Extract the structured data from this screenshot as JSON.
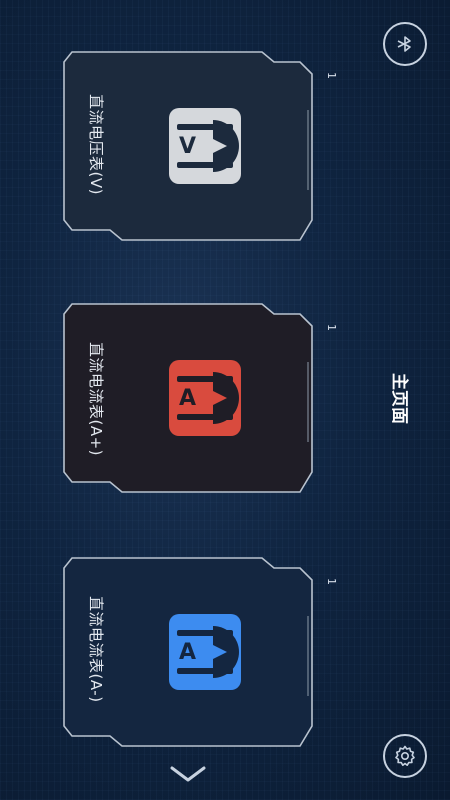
{
  "header": {
    "title": "主页面"
  },
  "cards": [
    {
      "label": "直流电压表(V)",
      "number": "1",
      "letter": "V",
      "color": "#d5d8dc",
      "bg": "#1c2a3d"
    },
    {
      "label": "直流电流表(A+)",
      "number": "1",
      "letter": "A",
      "color": "#d94b3e",
      "bg": "#1f1d26"
    },
    {
      "label": "直流电流表(A-)",
      "number": "1",
      "letter": "A",
      "color": "#3d8cf0",
      "bg": "#142640"
    }
  ],
  "icons": {
    "bluetooth": "bluetooth-icon",
    "settings": "gear-icon",
    "more": "chevron-down-icon"
  }
}
